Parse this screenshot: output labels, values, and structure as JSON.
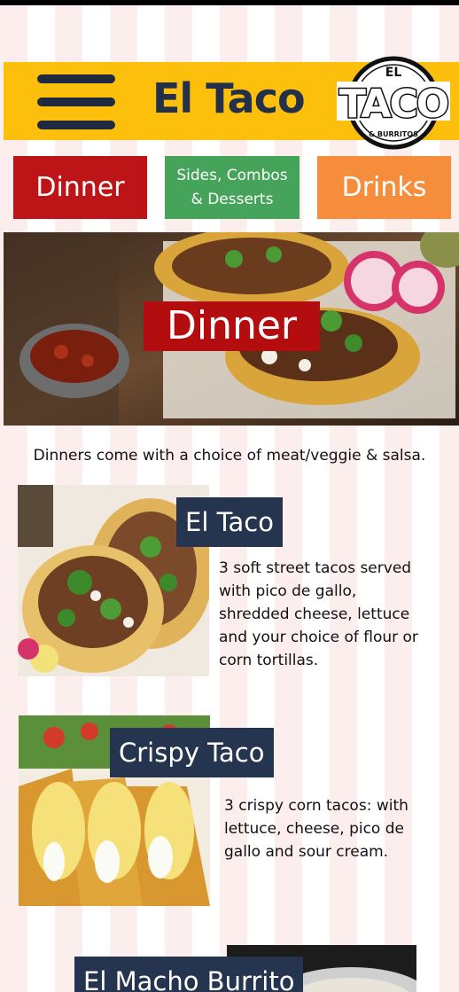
{
  "header": {
    "title": "El Taco",
    "logo_text": "TACO",
    "logo_small": "EL",
    "logo_sub": "& BURRITOS"
  },
  "nav": {
    "dinner": "Dinner",
    "sides": "Sides, Combos & Desserts",
    "sides_line1": "Sides, Combos",
    "sides_line2": "& Desserts",
    "drinks": "Drinks"
  },
  "hero": {
    "title": "Dinner"
  },
  "intro": "Dinners come with a choice of meat/veggie & salsa.",
  "dishes": [
    {
      "name": "El Taco",
      "desc_lines": [
        "3 soft street tacos served",
        "with pico de gallo,",
        "shredded cheese, lettuce",
        "and your choice of flour or",
        "corn tortillas."
      ]
    },
    {
      "name": "Crispy Taco",
      "desc_lines": [
        "3 crispy corn tacos: with",
        "lettuce, cheese, pico de",
        "gallo and sour cream."
      ]
    },
    {
      "name": "El Macho Burrito"
    }
  ],
  "colors": {
    "header_bg": "#fbbf0c",
    "dinner_btn": "#bd1417",
    "sides_btn": "#46a35a",
    "drinks_btn": "#f68d3c",
    "title_box": "#25344f",
    "hero_title_bg": "#b30d10"
  }
}
